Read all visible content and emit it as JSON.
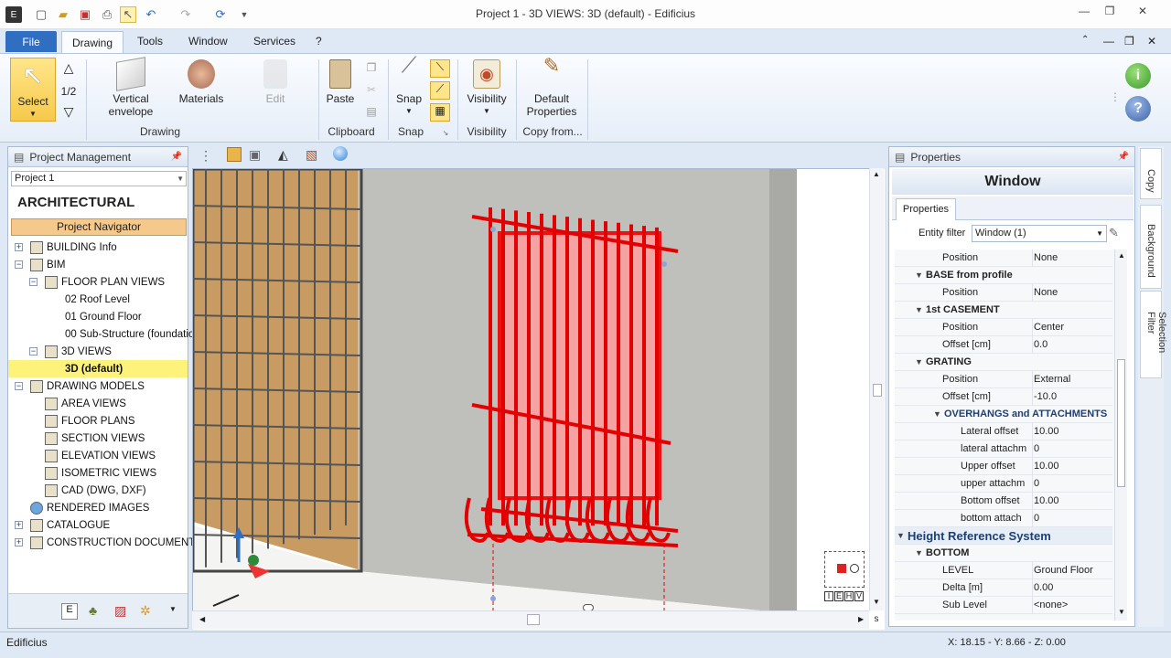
{
  "window": {
    "title": "Project 1 - 3D VIEWS: 3D (default) - Edificius",
    "minimize": "—",
    "restore": "❐",
    "close": "✕"
  },
  "menu": {
    "file": "File",
    "tabs": [
      "Drawing",
      "Tools",
      "Window",
      "Services",
      "?"
    ]
  },
  "ribbon": {
    "select": "Select",
    "half": "1/2",
    "vertical_envelope": "Vertical envelope",
    "materials": "Materials",
    "edit": "Edit",
    "paste": "Paste",
    "snap": "Snap",
    "visibility": "Visibility",
    "default_properties": "Default Properties",
    "groups": {
      "drawing": "Drawing",
      "clipboard": "Clipboard",
      "snap": "Snap",
      "visibility": "Visibility",
      "copy_from": "Copy from..."
    }
  },
  "project_panel": {
    "title": "Project Management",
    "project_select": "Project 1",
    "heading": "ARCHITECTURAL",
    "navigator": "Project Navigator",
    "tree": [
      {
        "label": "BUILDING Info",
        "toggle": "+"
      },
      {
        "label": "BIM",
        "toggle": "−"
      },
      {
        "label": "FLOOR PLAN VIEWS",
        "toggle": "−"
      },
      {
        "label": "02 Roof Level"
      },
      {
        "label": "01 Ground Floor"
      },
      {
        "label": "00 Sub-Structure (foundatio"
      },
      {
        "label": "3D VIEWS",
        "toggle": "−"
      },
      {
        "label": "3D (default)"
      },
      {
        "label": "DRAWING MODELS",
        "toggle": "−"
      },
      {
        "label": "AREA VIEWS"
      },
      {
        "label": "FLOOR PLANS"
      },
      {
        "label": "SECTION VIEWS"
      },
      {
        "label": "ELEVATION VIEWS"
      },
      {
        "label": "ISOMETRIC VIEWS"
      },
      {
        "label": "CAD (DWG, DXF)"
      },
      {
        "label": "RENDERED IMAGES"
      },
      {
        "label": "CATALOGUE",
        "toggle": "+"
      },
      {
        "label": "CONSTRUCTION DOCUMENTS S",
        "toggle": "+"
      }
    ]
  },
  "viewcube": {
    "letters": [
      "I",
      "E",
      "H",
      "V"
    ]
  },
  "properties": {
    "title": "Properties",
    "entity": "Window",
    "tab": "Properties",
    "entity_filter_label": "Entity filter",
    "entity_filter_value": "Window (1)",
    "rows": [
      {
        "name": "Position",
        "value": "None"
      },
      {
        "name": "BASE from profile",
        "section": true
      },
      {
        "name": "Position",
        "value": "None"
      },
      {
        "name": "1st CASEMENT",
        "section": true
      },
      {
        "name": "Position",
        "value": "Center"
      },
      {
        "name": "Offset  [cm]",
        "value": "0.0"
      },
      {
        "name": "GRATING",
        "section": true
      },
      {
        "name": "Position",
        "value": "External"
      },
      {
        "name": "Offset  [cm]",
        "value": "-10.0"
      },
      {
        "name": "OVERHANGS and ATTACHMENTS",
        "section": true
      },
      {
        "name": "Lateral offset",
        "value": "10.00"
      },
      {
        "name": "lateral attachm",
        "value": "0"
      },
      {
        "name": "Upper offset",
        "value": "10.00"
      },
      {
        "name": "upper attachm",
        "value": "0"
      },
      {
        "name": "Bottom offset",
        "value": "10.00"
      },
      {
        "name": "bottom attach",
        "value": "0"
      },
      {
        "name": "Height Reference System",
        "section": true
      },
      {
        "name": "BOTTOM",
        "section": true
      },
      {
        "name": "LEVEL",
        "value": "Ground Floor"
      },
      {
        "name": "Delta  [m]",
        "value": "0.00"
      },
      {
        "name": "Sub Level",
        "value": "<none>"
      }
    ]
  },
  "side_tabs": [
    "Copy",
    "Background",
    "Selection Filter"
  ],
  "status": {
    "app": "Edificius",
    "coords": "X: 18.15 - Y: 8.66 - Z: 0.00"
  }
}
